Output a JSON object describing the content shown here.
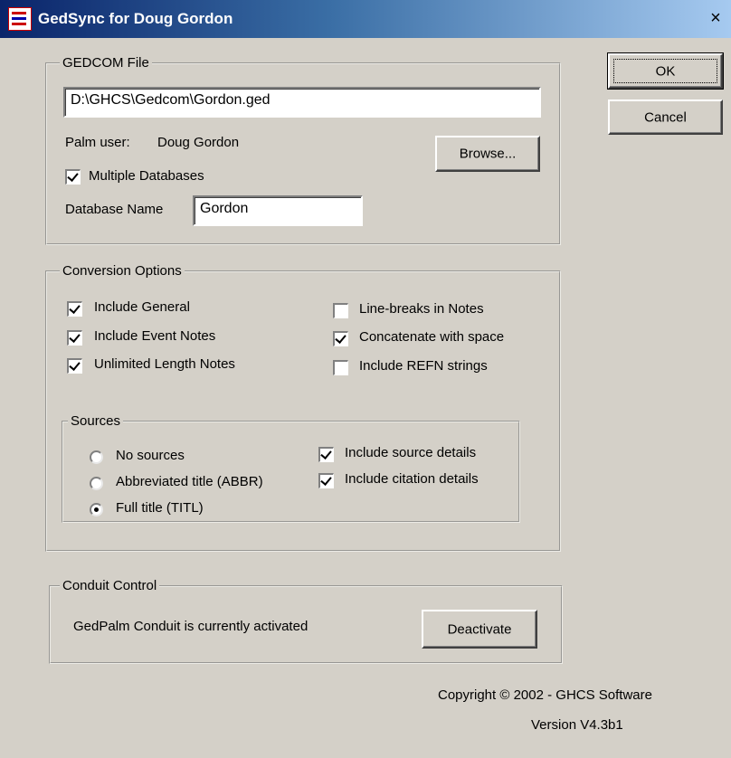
{
  "window": {
    "title": "GedSync for Doug Gordon",
    "close_glyph": "×",
    "icon": "gedsync-app-icon"
  },
  "buttons": {
    "ok": "OK",
    "cancel": "Cancel",
    "browse": "Browse...",
    "deactivate": "Deactivate"
  },
  "gedcom": {
    "legend": "GEDCOM File",
    "path": "D:\\GHCS\\Gedcom\\Gordon.ged",
    "palm_user_label": "Palm user:",
    "palm_user_value": "Doug Gordon",
    "multiple_databases": {
      "label": "Multiple Databases",
      "checked": true
    },
    "db_name_label": "Database Name",
    "db_name_value": "Gordon"
  },
  "conversion": {
    "legend": "Conversion Options",
    "options": [
      {
        "label": "Include General",
        "checked": true
      },
      {
        "label": "Include Event Notes",
        "checked": true
      },
      {
        "label": "Unlimited Length Notes",
        "checked": true
      },
      {
        "label": "Line-breaks in Notes",
        "checked": false
      },
      {
        "label": "Concatenate with space",
        "checked": true
      },
      {
        "label": "Include REFN strings",
        "checked": false
      }
    ],
    "sources": {
      "legend": "Sources",
      "radios": [
        {
          "label": "No sources",
          "selected": false
        },
        {
          "label": "Abbreviated title (ABBR)",
          "selected": false
        },
        {
          "label": "Full title (TITL)",
          "selected": true
        }
      ],
      "details": [
        {
          "label": "Include source details",
          "checked": true
        },
        {
          "label": "Include citation details",
          "checked": true
        }
      ]
    }
  },
  "conduit": {
    "legend": "Conduit Control",
    "status": "GedPalm Conduit is currently activated"
  },
  "footer": {
    "copyright": "Copyright © 2002 - GHCS Software",
    "version": "Version V4.3b1"
  },
  "colors": {
    "dialog_bg": "#d4d0c8",
    "titlebar_start": "#0a246a",
    "titlebar_end": "#a6caf0"
  }
}
